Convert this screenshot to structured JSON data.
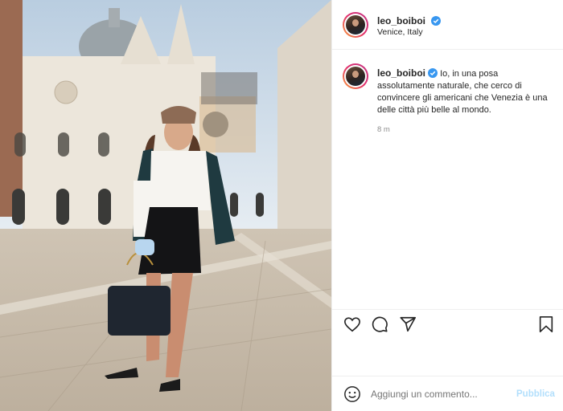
{
  "post": {
    "username": "leo_boiboi",
    "location": "Venice, Italy",
    "caption_user": "leo_boiboi",
    "caption_text": "Io, in una posa assolutamente naturale, che cerco di convincere gli americani che Venezia è una delle città più belle al mondo.",
    "time_ago": "8 m"
  },
  "comment": {
    "placeholder": "Aggiungi un commento...",
    "publish_label": "Pubblica"
  },
  "icons": {
    "like": "heart-icon",
    "comment": "comment-icon",
    "share": "paper-plane-icon",
    "save": "bookmark-icon",
    "emoji": "emoji-icon",
    "verified": "verified-badge-icon"
  },
  "colors": {
    "verified": "#3897f0",
    "publish_disabled": "#b2dffc",
    "muted": "#8e8e8e"
  }
}
